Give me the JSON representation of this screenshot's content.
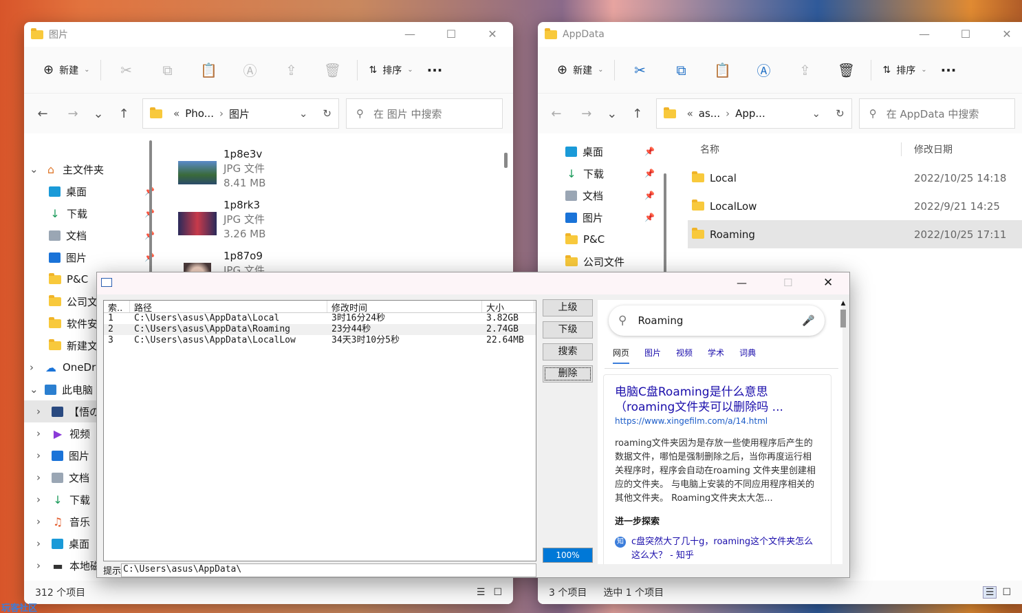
{
  "left": {
    "title": "图片",
    "cmd": {
      "new": "新建",
      "sort": "排序"
    },
    "breadcrumb": [
      "Pho...",
      "图片"
    ],
    "search_ph": "在 图片 中搜索",
    "tree": [
      {
        "label": "主文件夹",
        "icon": "home-icon"
      },
      {
        "label": "桌面",
        "icon": "desktop-icon",
        "pin": true
      },
      {
        "label": "下载",
        "icon": "download-icon",
        "pin": true
      },
      {
        "label": "文档",
        "icon": "document-icon",
        "pin": true
      },
      {
        "label": "图片",
        "icon": "picture-icon",
        "pin": true
      },
      {
        "label": "P&C",
        "icon": "folder-icon"
      },
      {
        "label": "公司文",
        "icon": "folder-icon"
      },
      {
        "label": "软件安",
        "icon": "folder-icon"
      },
      {
        "label": "新建文",
        "icon": "folder-icon"
      },
      {
        "label": "OneDri",
        "icon": "cloud-icon"
      },
      {
        "label": "此电脑",
        "icon": "pc-icon"
      },
      {
        "label": "【悟の",
        "icon": "phone-icon"
      },
      {
        "label": "视频",
        "icon": "video-icon"
      },
      {
        "label": "图片",
        "icon": "picture-icon"
      },
      {
        "label": "文档",
        "icon": "document-icon"
      },
      {
        "label": "下载",
        "icon": "download-icon"
      },
      {
        "label": "音乐",
        "icon": "music-icon"
      },
      {
        "label": "桌面",
        "icon": "desktop-icon"
      },
      {
        "label": "本地磁",
        "icon": "drive-icon"
      }
    ],
    "files": [
      {
        "name": "1p8e3v",
        "type": "JPG 文件",
        "size": "8.41 MB"
      },
      {
        "name": "1p8rk3",
        "type": "JPG 文件",
        "size": "3.26 MB"
      },
      {
        "name": "1p87o9",
        "type": "JPG 文件",
        "size": ""
      }
    ],
    "status": "312 个项目"
  },
  "right": {
    "title": "AppData",
    "cmd": {
      "new": "新建",
      "sort": "排序"
    },
    "breadcrumb": [
      "as...",
      "App..."
    ],
    "search_ph": "在 AppData 中搜索",
    "tree": [
      {
        "label": "桌面",
        "icon": "desktop-icon"
      },
      {
        "label": "下载",
        "icon": "download-icon"
      },
      {
        "label": "文档",
        "icon": "document-icon"
      },
      {
        "label": "图片",
        "icon": "picture-icon"
      },
      {
        "label": "P&C",
        "icon": "folder-icon"
      },
      {
        "label": "公司文件",
        "icon": "folder-icon"
      }
    ],
    "cols": {
      "name": "名称",
      "date": "修改日期"
    },
    "rows": [
      {
        "name": "Local",
        "date": "2022/10/25 14:18"
      },
      {
        "name": "LocalLow",
        "date": "2022/9/21 14:25"
      },
      {
        "name": "Roaming",
        "date": "2022/10/25 17:11"
      }
    ],
    "status": "3 个项目",
    "status2": "选中 1 个项目"
  },
  "dialog": {
    "headers": [
      "索..",
      "路径",
      "修改时间",
      "大小"
    ],
    "rows": [
      [
        "1",
        "C:\\Users\\asus\\AppData\\Local",
        "3时16分24秒",
        "3.82GB"
      ],
      [
        "2",
        "C:\\Users\\asus\\AppData\\Roaming",
        "23分44秒",
        "2.74GB"
      ],
      [
        "3",
        "C:\\Users\\asus\\AppData\\LocalLow",
        "34天3时10分5秒",
        "22.64MB"
      ]
    ],
    "btn_up": "上级",
    "btn_down": "下级",
    "btn_search": "搜索",
    "btn_delete": "删除",
    "progress": "100%",
    "progress_value": 1.0,
    "tip_label": "提示",
    "tip_value": "C:\\Users\\asus\\AppData\\"
  },
  "web": {
    "query": "Roaming",
    "tabs": [
      "网页",
      "图片",
      "视频",
      "学术",
      "词典"
    ],
    "result_title": "电脑C盘Roaming是什么意思（roaming文件夹可以删除吗 ...",
    "result_url": "https://www.xingefilm.com/a/14.html",
    "result_body": "roaming文件夹因为是存放一些使用程序后产生的数据文件，哪怕是强制删除之后，当你再度运行相关程序时，程序会自动在roaming 文件夹里创建相应的文件夹。 与电脑上安装的不同应用程序相关的其他文件夹。 Roaming文件夹太大怎...",
    "more": "进一步探索",
    "more_link": "c盘突然大了几十g，roaming这个文件夹怎么这么大？ - 知乎",
    "zhihu_badge": "知"
  },
  "watermark": "玩客社区"
}
